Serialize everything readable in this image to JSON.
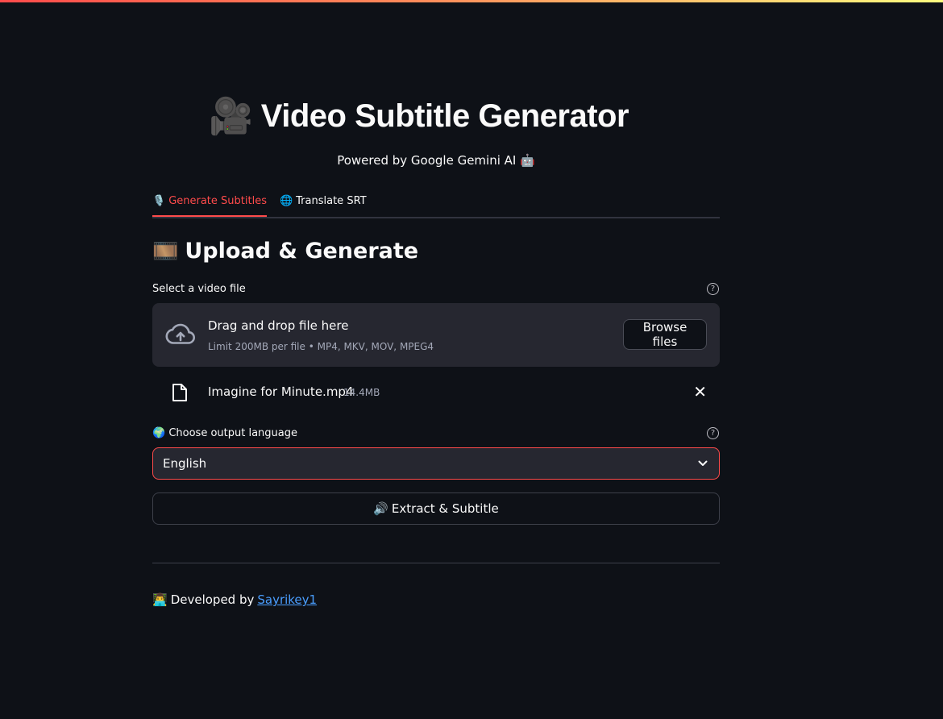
{
  "header": {
    "title_icon": "🎥",
    "title": "Video Subtitle Generator",
    "subtitle": "Powered by Google Gemini AI 🤖"
  },
  "tabs": [
    {
      "icon": "🎙️",
      "label": "Generate Subtitles",
      "active": true
    },
    {
      "icon": "🌐",
      "label": "Translate SRT",
      "active": false
    }
  ],
  "section": {
    "icon": "🎞️",
    "title": "Upload & Generate"
  },
  "uploader": {
    "label": "Select a video file",
    "drag_text": "Drag and drop file here",
    "limit_text": "Limit 200MB per file • MP4, MKV, MOV, MPEG4",
    "browse_label": "Browse files",
    "file_name": "Imagine for Minute.mp4",
    "file_size": "14.4MB"
  },
  "language": {
    "label": "🌍 Choose output language",
    "selected": "English"
  },
  "actions": {
    "extract_icon": "🔊",
    "extract_label": "Extract & Subtitle"
  },
  "footer": {
    "icon": "👨‍💻",
    "text": "Developed by",
    "link_text": "Sayrikey1"
  },
  "colors": {
    "accent": "#ff4b4b",
    "background": "#0e1117",
    "surface": "#262730",
    "link": "#4a9eff"
  }
}
